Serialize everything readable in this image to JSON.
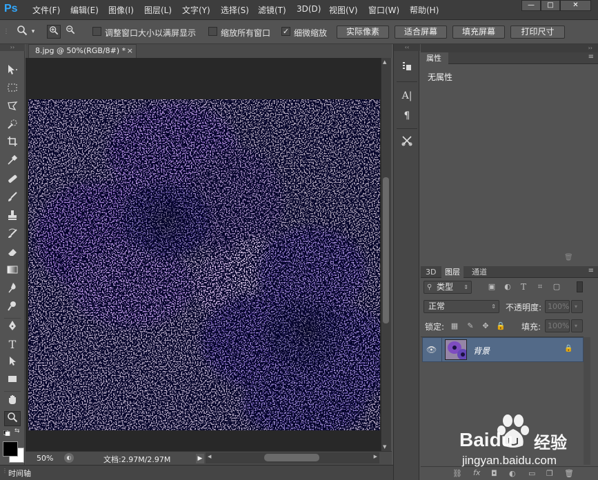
{
  "app": {
    "logo": "Ps"
  },
  "menu": [
    "文件(F)",
    "编辑(E)",
    "图像(I)",
    "图层(L)",
    "文字(Y)",
    "选择(S)",
    "滤镜(T)",
    "3D(D)",
    "视图(V)",
    "窗口(W)",
    "帮助(H)"
  ],
  "window_controls": {
    "minimize": "—",
    "maximize": "□",
    "close": "✕"
  },
  "options_bar": {
    "check1_label": "调整窗口大小以满屏显示",
    "check2_label": "缩放所有窗口",
    "check3_label": "细微缩放",
    "check1_checked": false,
    "check2_checked": false,
    "check3_checked": true,
    "btn_actual": "实际像素",
    "btn_fit": "适合屏幕",
    "btn_fill": "填充屏幕",
    "btn_print": "打印尺寸"
  },
  "document": {
    "tab_title": "8.jpg @ 50%(RGB/8#) *",
    "tab_close": "×",
    "zoom": "50%",
    "doc_info": "文档:2.97M/2.97M"
  },
  "timeline": {
    "label": "时间轴"
  },
  "properties": {
    "tab": "属性",
    "empty": "无属性"
  },
  "layers_panel": {
    "tabs": [
      "3D",
      "图层",
      "通道"
    ],
    "active_tab": "图层",
    "filter_kind": "类型",
    "blend_mode": "正常",
    "opacity_label": "不透明度:",
    "opacity_value": "100%",
    "lock_label": "锁定:",
    "fill_label": "填充:",
    "fill_value": "100%",
    "layer_name": "背景"
  },
  "watermark": {
    "brand": "Baidu",
    "brand_cn": "经验",
    "url": "jingyan.baidu.com"
  },
  "colors": {
    "accent": "#31a8ff",
    "layer_selected": "#536a88",
    "panel_bg": "#535353",
    "canvas_bg": "#282828",
    "menubar_bg": "#3d3d3d"
  }
}
